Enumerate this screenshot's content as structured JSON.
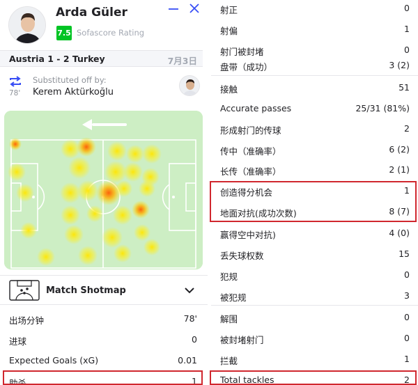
{
  "header": {
    "player_name": "Arda Güler",
    "rating": "7.5",
    "rating_label": "Sofascore Rating",
    "rating_color": "#00c424",
    "minimize_icon": "minimize-icon",
    "close_icon": "close-icon"
  },
  "match": {
    "teams": "Austria 1 - 2 Turkey",
    "date": "7月3日"
  },
  "substitution": {
    "label": "Substituted off by:",
    "player": "Kerem Aktürkoğlu",
    "minute": "78'"
  },
  "shotmap": {
    "label": "Match Shotmap"
  },
  "left_stats": [
    {
      "label": "出场分钟",
      "value": "78'"
    },
    {
      "label": "进球",
      "value": "0"
    },
    {
      "label": "Expected Goals (xG)",
      "value": "0.01"
    },
    {
      "label": "助杀",
      "value": "1"
    }
  ],
  "right_stats": [
    {
      "label": "射正",
      "value": "0"
    },
    {
      "label": "射偏",
      "value": "1"
    },
    {
      "label": "射门被封堵",
      "value": "0"
    },
    {
      "label": "盘带（成功）",
      "value": "3 (2)"
    },
    {
      "label": "接触",
      "value": "51"
    },
    {
      "label": "Accurate passes",
      "value": "25/31 (81%)"
    },
    {
      "label": "形成射门的传球",
      "value": "2"
    },
    {
      "label": "传中（准确率）",
      "value": "6 (2)"
    },
    {
      "label": "长传（准确率）",
      "value": "2 (1)"
    },
    {
      "label": "创造得分机会",
      "value": "1"
    },
    {
      "label": "地面对抗(成功次数)",
      "value": "8 (7)"
    },
    {
      "label": "赢得空中对抗)",
      "value": "4 (0)"
    },
    {
      "label": "丢失球权数",
      "value": "15"
    },
    {
      "label": "犯规",
      "value": "0"
    },
    {
      "label": "被犯规",
      "value": "3"
    },
    {
      "label": "解围",
      "value": "0"
    },
    {
      "label": "被封堵射门",
      "value": "0"
    },
    {
      "label": "拦截",
      "value": "1"
    },
    {
      "label": "Total tackles",
      "value": "2"
    }
  ],
  "colors": {
    "accent": "#374df5",
    "highlight": "#d0272e",
    "pitch": "#cdeec4"
  }
}
